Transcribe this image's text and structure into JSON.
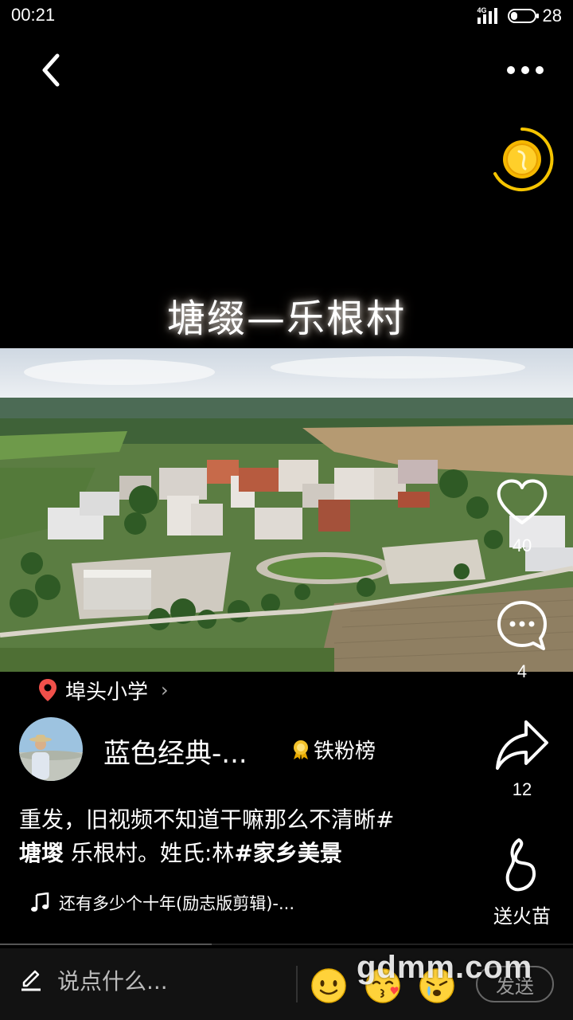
{
  "status_bar": {
    "time": "00:21",
    "network": "4G",
    "battery": "28",
    "battery_level": 0.28
  },
  "header": {
    "back_icon": "chevron-left-icon",
    "more_icon": "more-dots-icon"
  },
  "video": {
    "title_overlay": "塘缀—乐根村"
  },
  "actions": {
    "like_count": "40",
    "comment_count": "4",
    "share_count": "12",
    "fire_label": "送火苗"
  },
  "location": {
    "name": "埠头小学",
    "chevron": "›"
  },
  "author": {
    "name": "蓝色经典-...",
    "badge": "铁粉榜"
  },
  "caption": {
    "line1": "重发，旧视频不知道干嘛那么不清晰#",
    "tag1": "塘堫",
    "text2": " 乐根村。姓氏:林",
    "tag2": "#家乡美景"
  },
  "music": {
    "title": "还有多少个十年(励志版剪辑)-..."
  },
  "progress": {
    "played": 0.37
  },
  "bottom_bar": {
    "placeholder": "说点什么...",
    "send_label": "发送"
  },
  "watermark": "gdmm.com",
  "colors": {
    "background": "#000000",
    "location_pin": "#f0504a",
    "coin": "#f5b800",
    "bottom_bar": "#121212"
  }
}
